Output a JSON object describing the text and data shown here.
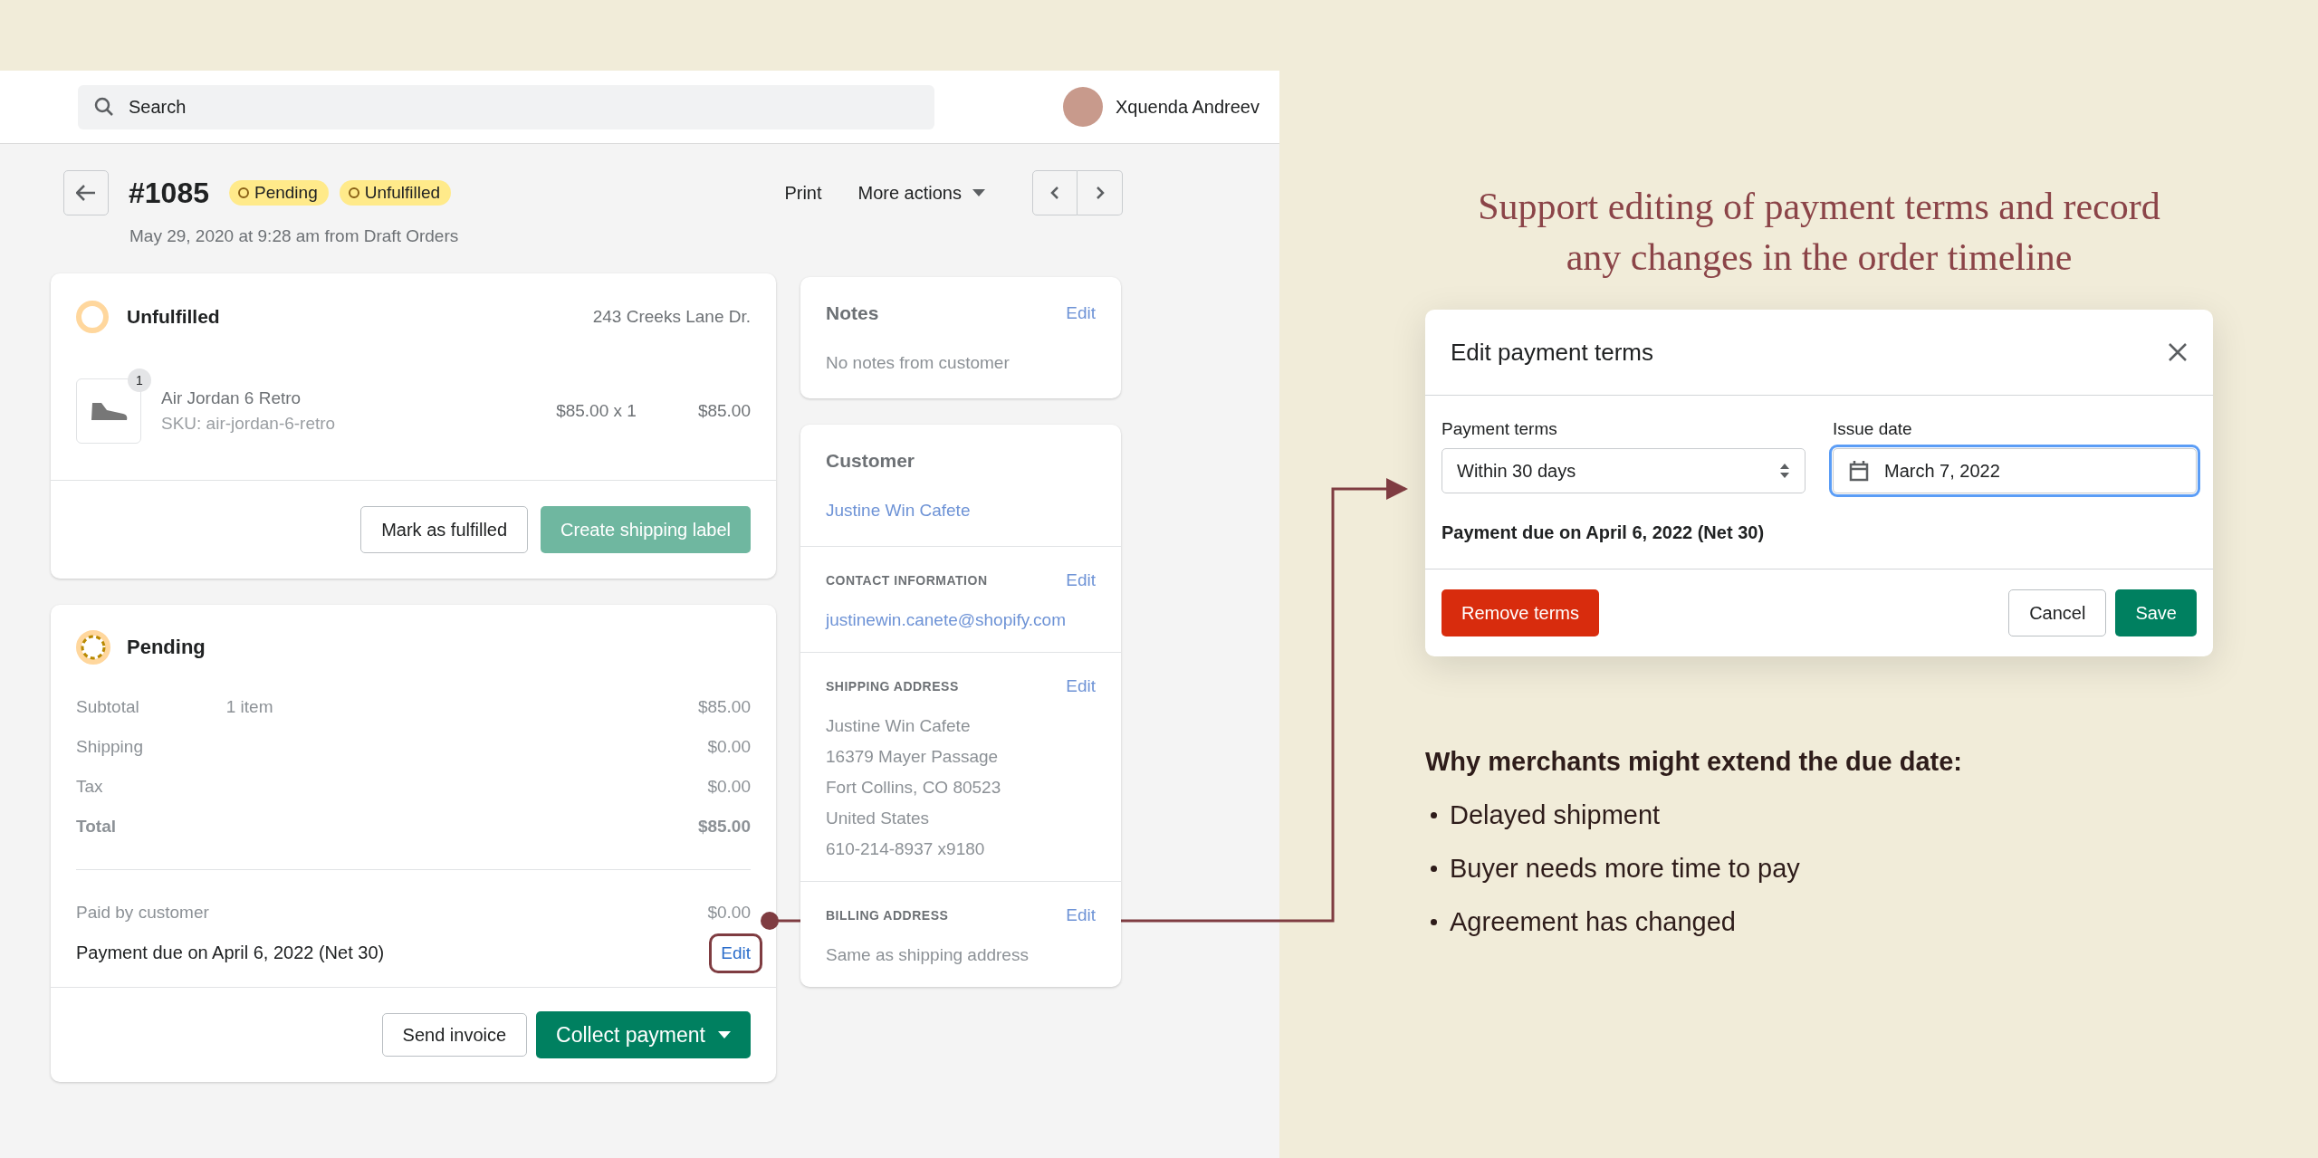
{
  "header": {
    "search": {
      "placeholder": "Search"
    },
    "user": {
      "name": "Xquenda Andreev"
    }
  },
  "order": {
    "number": "#1085",
    "badges": [
      {
        "label": "Pending"
      },
      {
        "label": "Unfulfilled"
      }
    ],
    "subtitle": "May 29, 2020 at 9:28 am from Draft Orders",
    "actions": [
      {
        "label": "Print",
        "kind": "plain"
      },
      {
        "label": "More actions",
        "kind": "menu"
      }
    ]
  },
  "fulfillment_card": {
    "title": "Unfulfilled",
    "address": "243 Creeks Lane Dr.",
    "item": {
      "quantity": "1",
      "name": "Air Jordan 6 Retro",
      "sku": "SKU: air-jordan-6-retro",
      "unit_price": "$85.00 x 1",
      "total": "$85.00"
    },
    "buttons": [
      {
        "label": "Mark as fulfilled",
        "kind": "secondary"
      },
      {
        "label": "Create shipping label",
        "kind": "primary"
      }
    ]
  },
  "payment_card": {
    "title": "Pending",
    "rows": [
      {
        "label": "Subtotal",
        "detail": "1 item",
        "amount": "$85.00",
        "kind": "line"
      },
      {
        "label": "Shipping",
        "amount": "$0.00",
        "kind": "line"
      },
      {
        "label": "Tax",
        "amount": "$0.00",
        "kind": "line"
      },
      {
        "label": "Total",
        "amount": "$85.00",
        "kind": "total"
      }
    ],
    "paid": {
      "label": "Paid by customer",
      "amount": "$0.00"
    },
    "due": {
      "text": "Payment due on April 6, 2022 (Net 30)",
      "link": "Edit"
    },
    "buttons": [
      {
        "label": "Send invoice",
        "kind": "secondary"
      },
      {
        "label": "Collect payment",
        "kind": "primary_menu"
      }
    ]
  },
  "notes_card": {
    "title": "Notes",
    "action": "Edit",
    "text": "No notes from customer"
  },
  "customer_card": {
    "title": "Customer",
    "name": "Justine Win Cafete",
    "sections": [
      {
        "heading": "CONTACT INFORMATION",
        "action": "Edit",
        "kind": "link",
        "lines": [
          "justinewin.canete@shopify.com"
        ]
      },
      {
        "heading": "SHIPPING ADDRESS",
        "action": "Edit",
        "kind": "text",
        "lines": [
          "Justine Win Cafete",
          "16379 Mayer Passage",
          "Fort Collins, CO 80523",
          "United States",
          "610-214-8937 x9180"
        ]
      },
      {
        "heading": "BILLING ADDRESS",
        "action": "Edit",
        "kind": "text",
        "lines": [
          "Same as shipping address"
        ]
      }
    ]
  },
  "headline": "Support editing of payment terms and record any changes in the order timeline",
  "dialog": {
    "title": "Edit payment terms",
    "terms": {
      "label": "Payment terms",
      "value": "Within 30 days"
    },
    "issue_date": {
      "label": "Issue date",
      "value": "March 7, 2022",
      "focused": true
    },
    "due_text": "Payment due on April 6, 2022 (Net 30)",
    "buttons": [
      {
        "label": "Remove terms",
        "kind": "destructive"
      },
      {
        "label": "Cancel",
        "kind": "secondary"
      },
      {
        "label": "Save",
        "kind": "primary"
      }
    ]
  },
  "reasons": {
    "heading": "Why merchants might extend the due date:",
    "items": [
      "Delayed shipment",
      "Buyer needs more time to pay",
      "Agreement has changed"
    ]
  }
}
